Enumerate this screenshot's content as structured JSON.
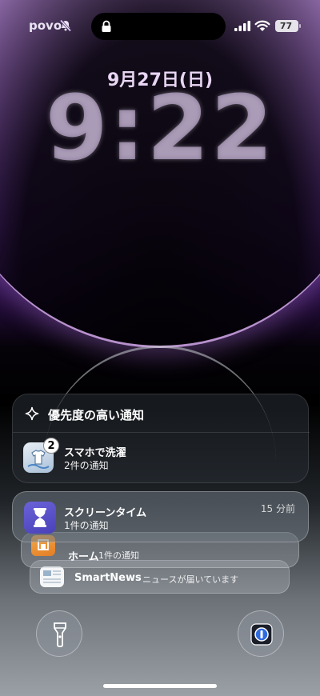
{
  "status_bar": {
    "carrier": "povo",
    "mute_icon": "bell-slash-icon",
    "lock_icon": "lock-icon",
    "battery": "77"
  },
  "lock_screen": {
    "date": "9月27日(日)",
    "time": "9:22"
  },
  "priority_group": {
    "title": "優先度の高い通知",
    "icon": "sparkle-icon",
    "item": {
      "app": "スマホで洗濯",
      "summary": "2件の通知",
      "badge": "2"
    }
  },
  "notifications": [
    {
      "app": "スクリーンタイム",
      "summary": "1件の通知",
      "time_ago": "15 分前",
      "icon": "hourglass-icon"
    },
    {
      "app": "ホーム",
      "summary": "1件の通知",
      "icon": "home-icon"
    },
    {
      "app": "SmartNews",
      "summary": "ニュースが届いています",
      "icon": "smartnews-icon"
    }
  ],
  "bottom_controls": {
    "left": "flashlight-icon",
    "right": "password-manager-icon"
  },
  "colors": {
    "accent_purple": "#7a4f9c",
    "screentime_icon": "#5a52c8",
    "home_icon": "#e98a30"
  }
}
